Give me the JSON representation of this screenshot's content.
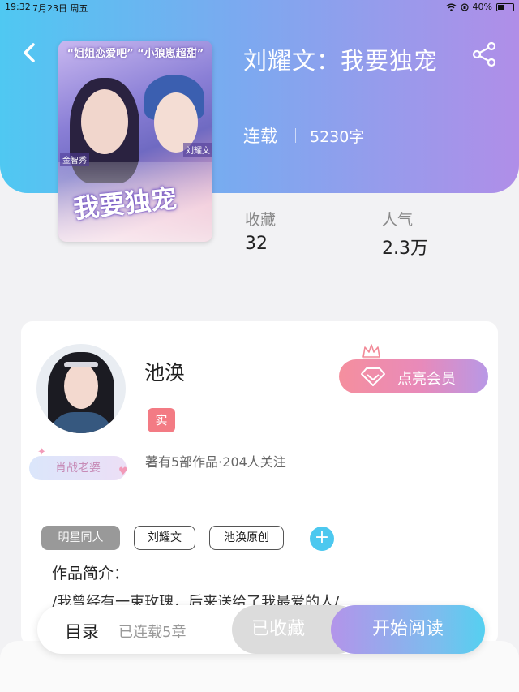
{
  "status_bar": {
    "time": "19:32",
    "date": "7月23日 周五",
    "battery": "40%"
  },
  "book": {
    "title": "刘耀文：我要独宠",
    "status": "连载",
    "word_count": "5230字",
    "stats": [
      {
        "label": "收藏",
        "value": "32"
      },
      {
        "label": "人气",
        "value": "2.3万"
      }
    ],
    "cover": {
      "slogan": "“姐姐恋爱吧” “小狼崽超甜”",
      "title": "我要独宠",
      "name_left": "金智秀",
      "name_right": "刘耀文"
    }
  },
  "author": {
    "name": "池涣",
    "verified_label": "实",
    "fan_badge": "肖战老婆",
    "stats": "著有5部作品·204人关注",
    "vip_button": "点亮会员"
  },
  "tags": [
    "明星同人",
    "刘耀文",
    "池涣原创"
  ],
  "intro": {
    "title": "作品简介：",
    "text": "/我曾经有一束玫瑰，后来送给了我最爱的人/"
  },
  "bottom_bar": {
    "toc": "目录",
    "chapters": "已连载5章",
    "favorited": "已收藏",
    "read": "开始阅读"
  },
  "colors": {
    "header_start": "#4fc8f2",
    "header_end": "#b08ee8",
    "vip": "#f58f9e",
    "verified": "#f37b84",
    "add_tag": "#4cc8ef"
  },
  "icons": [
    "back-arrow-icon",
    "share-icon",
    "wifi-icon",
    "battery-icon",
    "diamond-icon",
    "crown-icon",
    "plus-icon"
  ]
}
